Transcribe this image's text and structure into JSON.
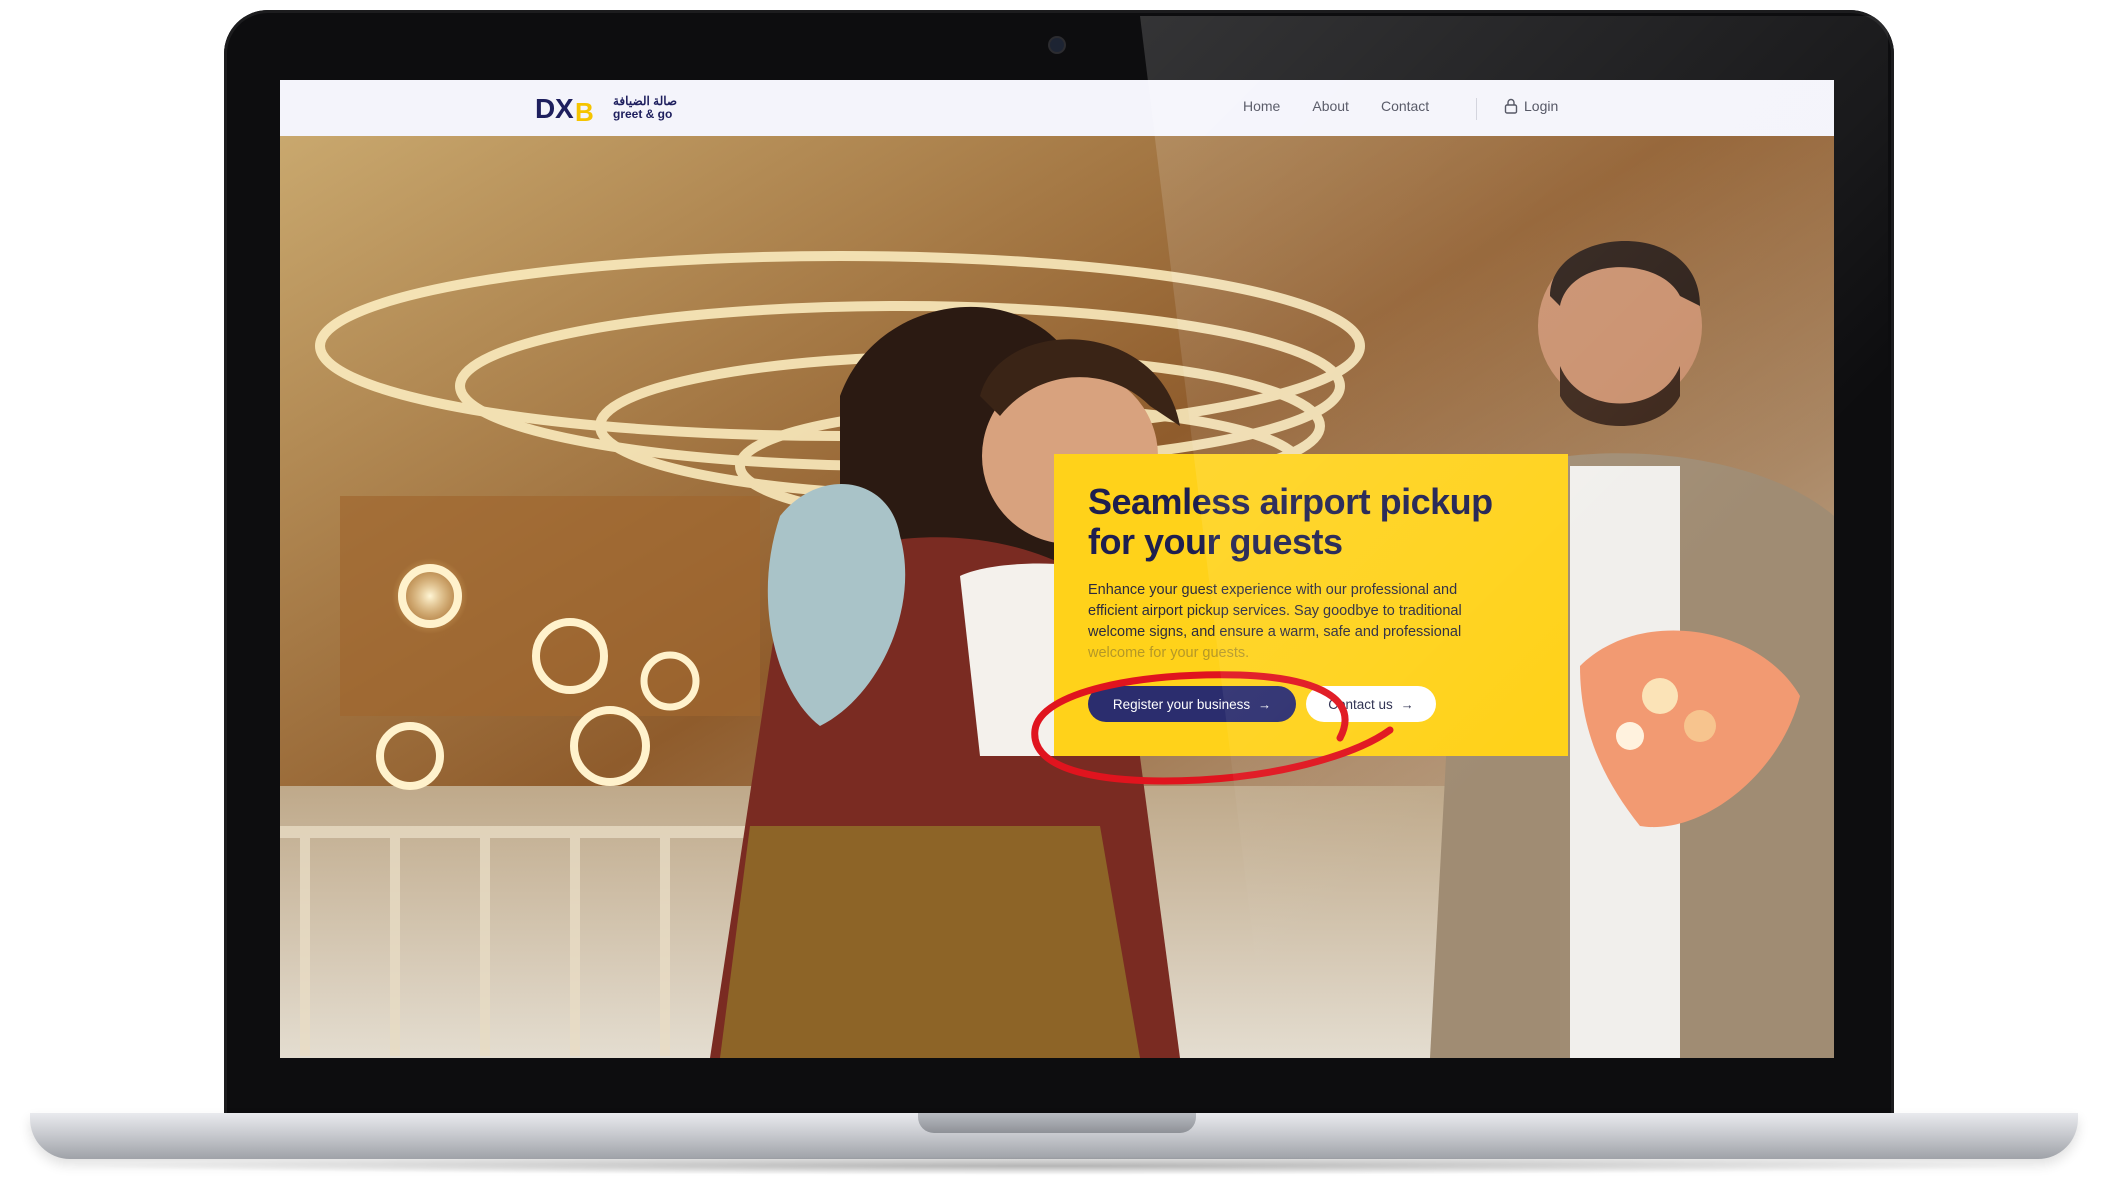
{
  "brand": {
    "logo_ar": "صالة الضيافة",
    "logo_en": "greet & go"
  },
  "nav": {
    "links": [
      "Home",
      "About",
      "Contact"
    ],
    "login_label": "Login"
  },
  "hero": {
    "title_line1": "Seamless airport pickup",
    "title_line2": "for your guests",
    "description": "Enhance your guest experience with our professional and efficient airport pickup services. Say goodbye to traditional welcome signs, and ensure a warm, safe and professional",
    "description_obscured": "welcome for your guests.",
    "primary_cta": "Register your business",
    "secondary_cta": "Contact us",
    "arrow_glyph": "→"
  },
  "colors": {
    "accent_yellow": "#ffd21a",
    "brand_navy": "#2b2d6e",
    "annotation_red": "#e0141e"
  },
  "icons": {
    "login": "lock-icon",
    "cta_arrow": "arrow-right-icon"
  }
}
